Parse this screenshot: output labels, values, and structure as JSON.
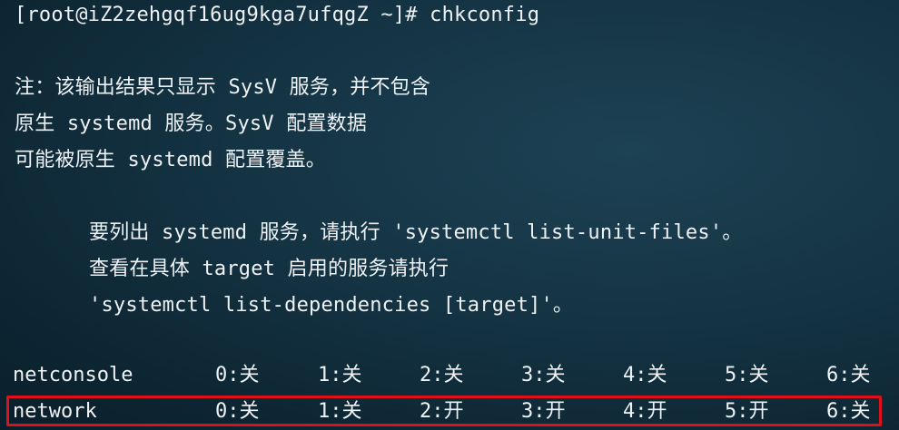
{
  "terminal": {
    "prompt_line": "[root@iZ2zehgqf16ug9kga7ufqgZ ~]# chkconfig",
    "note_lines": [
      "注：该输出结果只显示 SysV 服务，并不包含",
      "原生 systemd 服务。SysV 配置数据",
      "可能被原生 systemd 配置覆盖。"
    ],
    "hint_lines": [
      "要列出 systemd 服务，请执行 'systemctl list-unit-files'。",
      "查看在具体 target 启用的服务请执行",
      "'systemctl list-dependencies [target]'。"
    ],
    "services": [
      {
        "name": "netconsole",
        "levels": [
          "0:关",
          "1:关",
          "2:关",
          "3:关",
          "4:关",
          "5:关",
          "6:关"
        ]
      },
      {
        "name": "network",
        "levels": [
          "0:关",
          "1:关",
          "2:开",
          "3:开",
          "4:开",
          "5:开",
          "6:关"
        ]
      }
    ]
  },
  "colors": {
    "background": "#143343",
    "text": "#eef2f4",
    "highlight_border": "#e0101a"
  }
}
